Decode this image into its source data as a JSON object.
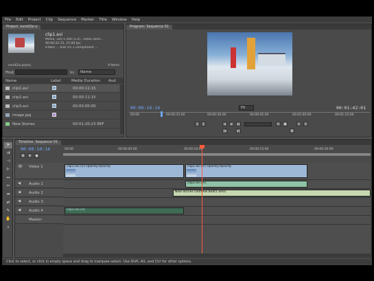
{
  "menu": [
    "File",
    "Edit",
    "Project",
    "Clip",
    "Sequence",
    "Marker",
    "Title",
    "Window",
    "Help"
  ],
  "project": {
    "tab": "Project: evroll2e-o",
    "clip_name": "clip1.avi",
    "clip_info": [
      "Movie, 320 x 240 (1.0) , video used...",
      "00:00:22:15, 15.00 fps",
      "8 KB/s ... 658 Tcc 1 compliment ..."
    ],
    "item_count": "9 Items",
    "project_name": "evroll2a.prproj",
    "find_label": "Find:",
    "in_label": "In:",
    "in_value": "Name",
    "columns": [
      "Name",
      "Label",
      "Media Duration",
      "Aud"
    ],
    "items": [
      {
        "name": "clip1.avi",
        "duration": "00:00:11:15"
      },
      {
        "name": "clip2.avi",
        "duration": "00:00:11:15"
      },
      {
        "name": "clip3.avi",
        "duration": "00:00:00:00"
      },
      {
        "name": "image.jpg",
        "duration": ""
      },
      {
        "name": "New Stories",
        "duration": "00:01:20:23 REF"
      }
    ]
  },
  "program": {
    "tab": "Program: Sequence 01",
    "timecode": "00:00:10:14",
    "fit": "Fit",
    "duration": "00:01:42:01",
    "ruler": [
      "00:00",
      "00:00:15:00",
      "00:00:30:00",
      "00:00:45:00",
      "00:01:00:00",
      "00:01:15:00"
    ]
  },
  "timeline": {
    "tab": "Timeline: Sequence 01",
    "timecode": "00:00:10:14",
    "ruler": [
      "00:00",
      "00:00:05:00",
      "00:00:10:00",
      "00:00:15:00",
      "00:00:20:00"
    ],
    "tracks": [
      {
        "name": "Video 1",
        "type": "video"
      },
      {
        "name": "Audio 1",
        "type": "audio"
      },
      {
        "name": "Audio 2",
        "type": "audio"
      },
      {
        "name": "Audio 3",
        "type": "audio"
      },
      {
        "name": "Audio 4",
        "type": "audio"
      },
      {
        "name": "Master",
        "type": "master"
      }
    ],
    "clips": {
      "v1a": "clip1.avi [V] Opacity:Opacity",
      "v1b": "clip2.avi [V] Opacity:Opacity",
      "a1": "clip2.avi [A]",
      "a2": "New Stories Old/New Beat1.wma",
      "a4": "clip1.avi [A]"
    }
  },
  "status": "Click to select, or click in empty space and drag to marquee select. Use Shift, Alt, and Ctrl for other options.",
  "colors": {
    "video_clip": "#9db8d6",
    "audio_clip": "#8fc2a6",
    "playhead": "#ff5a3c"
  }
}
